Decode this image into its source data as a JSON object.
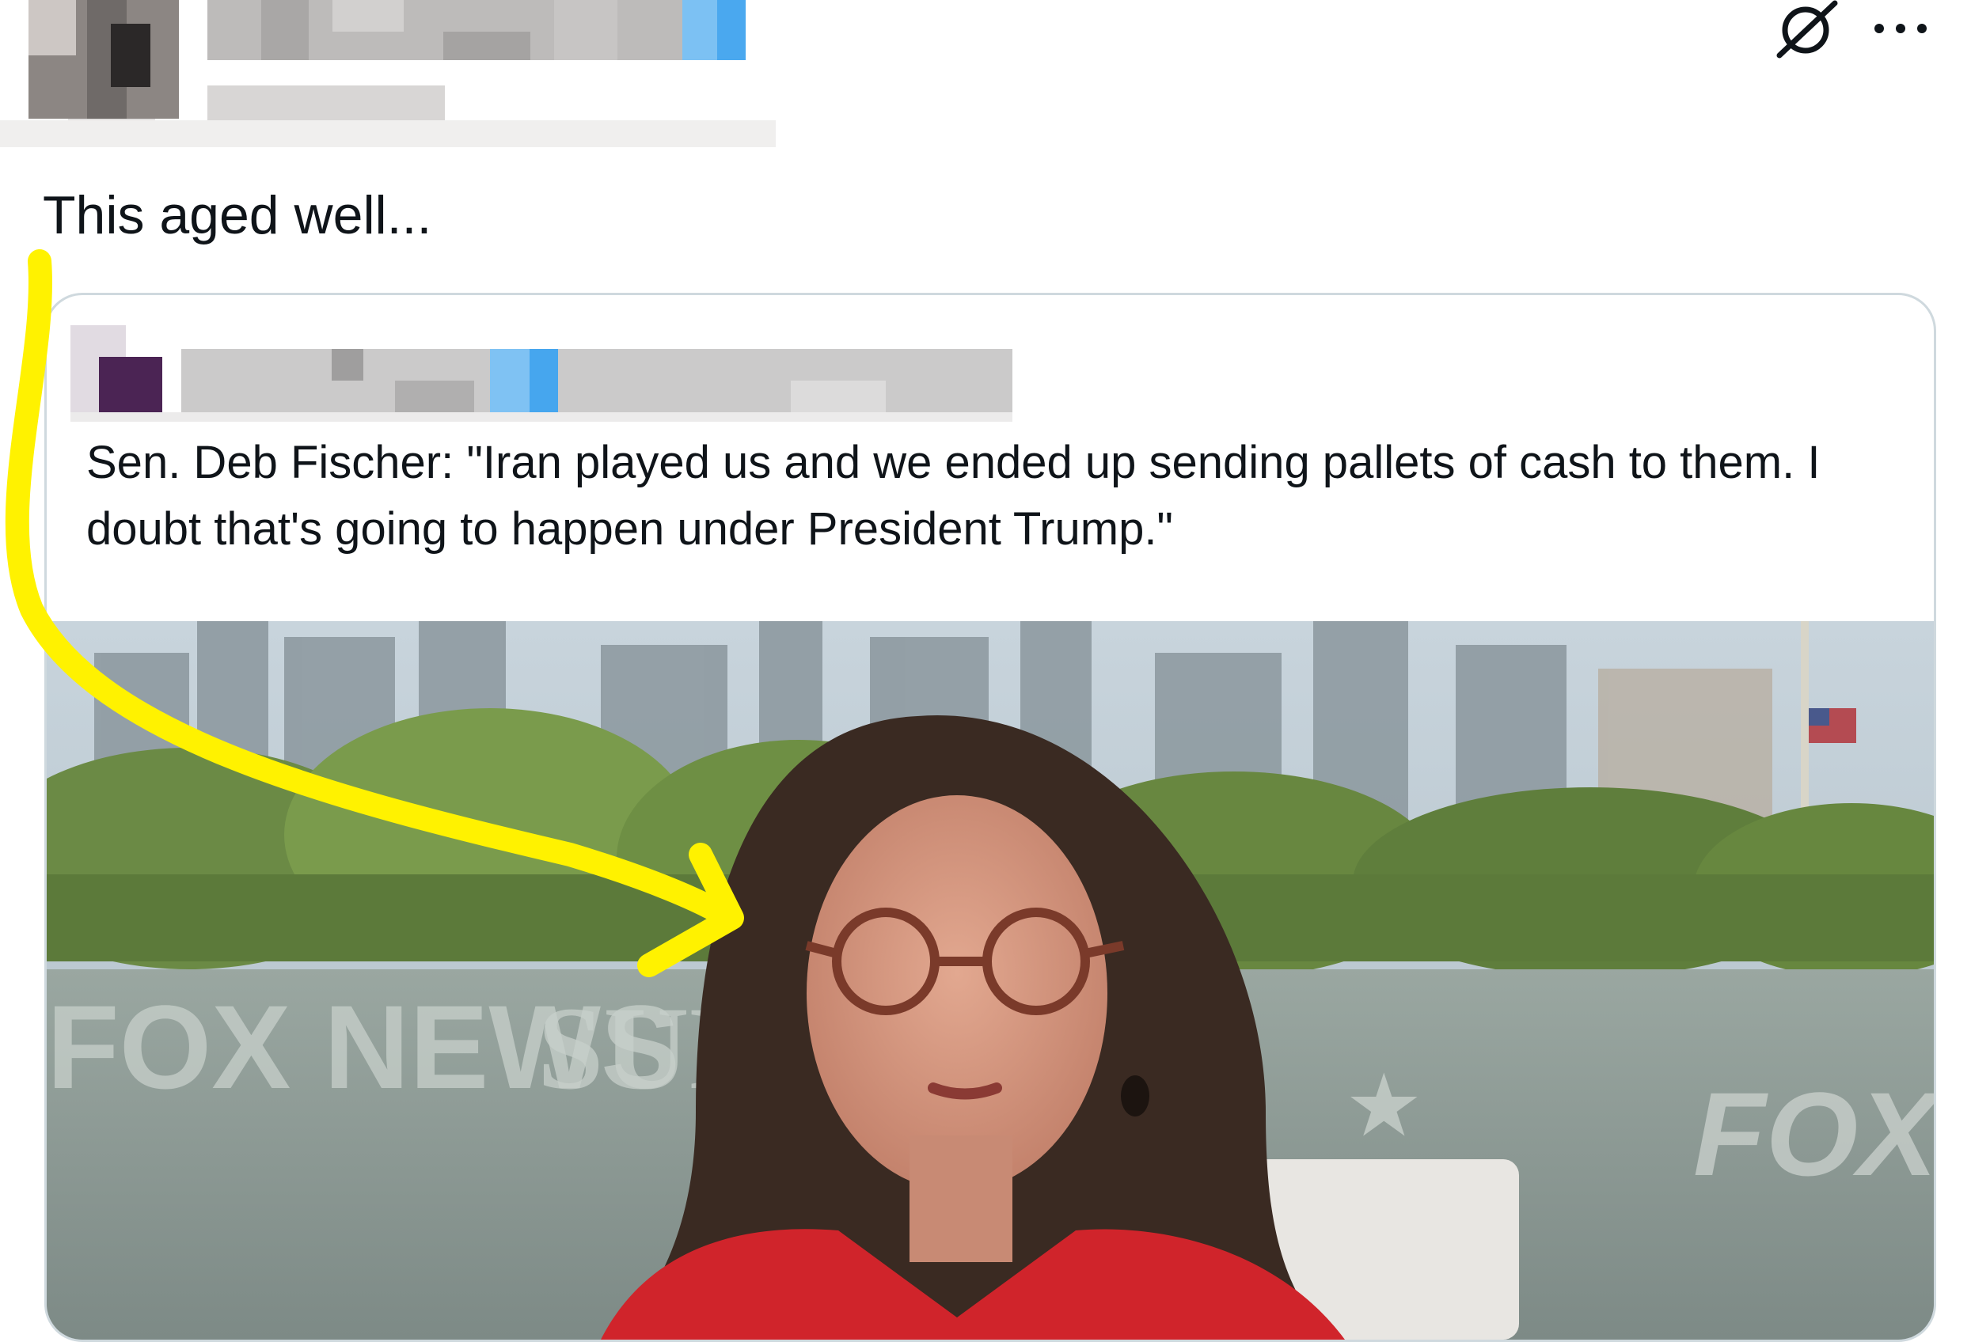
{
  "post": {
    "text": "This aged well...",
    "author_redacted": true
  },
  "toolbar": {
    "grok_icon": "grok-slash-icon",
    "more_icon": "more-horizontal-icon"
  },
  "quoted_post": {
    "author_redacted": true,
    "text": "Sen. Deb Fischer: \"Iran played us and we ended up sending pallets of cash to them. I doubt that's going to happen under President Trump.\""
  },
  "media": {
    "type": "video-thumbnail",
    "background_text_1": "FOX NEWS",
    "background_text_2": "SUN",
    "background_text_3": "FOX"
  },
  "annotation": {
    "arrow_color": "#FFF200"
  },
  "colors": {
    "blue_check": "#1D9BF0",
    "border": "#CFD9DE",
    "text": "#0F1419",
    "jacket": "#D0242B"
  }
}
